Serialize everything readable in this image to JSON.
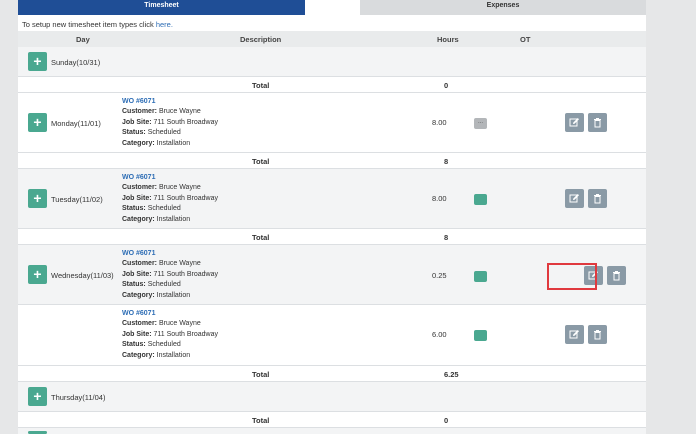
{
  "tabs": [
    {
      "label": "Timesheet",
      "active": true
    },
    {
      "label": "Expenses",
      "active": false
    }
  ],
  "intro": {
    "text": "To setup new timesheet item types click ",
    "link": "here."
  },
  "columns": {
    "day": "Day",
    "description": "Description",
    "hours": "Hours",
    "ot": "OT"
  },
  "labels": {
    "customer": "Customer:",
    "job_site": "Job Site:",
    "status": "Status:",
    "category": "Category:",
    "total": "Total"
  },
  "days": [
    {
      "label": "Sunday(10/31)",
      "total": "0"
    },
    {
      "label": "Monday(11/01)",
      "total": "8"
    },
    {
      "label": "Tuesday(11/02)",
      "total": "8"
    },
    {
      "label": "Wednesday(11/03)",
      "total": "6.25"
    },
    {
      "label": "Thursday(11/04)",
      "total": "0"
    }
  ],
  "entries": [
    {
      "wo": "WO #6071",
      "customer": "Bruce Wayne",
      "job_site": "711 South Broadway",
      "status": "Scheduled",
      "category": "Installation",
      "hours": "8.00",
      "ot": "..."
    },
    {
      "wo": "WO #6071",
      "customer": "Bruce Wayne",
      "job_site": "711 South Broadway",
      "status": "Scheduled",
      "category": "Installation",
      "hours": "8.00"
    },
    {
      "wo": "WO #6071",
      "customer": "Bruce Wayne",
      "job_site": "711 South Broadway",
      "status": "Scheduled",
      "category": "Installation",
      "hours": "0.25"
    },
    {
      "wo": "WO #6071",
      "customer": "Bruce Wayne",
      "job_site": "711 South Broadway",
      "status": "Scheduled",
      "category": "Installation",
      "hours": "6.00"
    }
  ],
  "icons": {
    "add": "plus-icon",
    "edit": "pencil-square-icon",
    "delete": "trash-icon"
  },
  "colors": {
    "tab_active": "#1f4e96",
    "add_green": "#4aa890",
    "action_gray": "#8a9aa6",
    "link_blue": "#2d6db5",
    "highlight_red": "#e0393e"
  }
}
